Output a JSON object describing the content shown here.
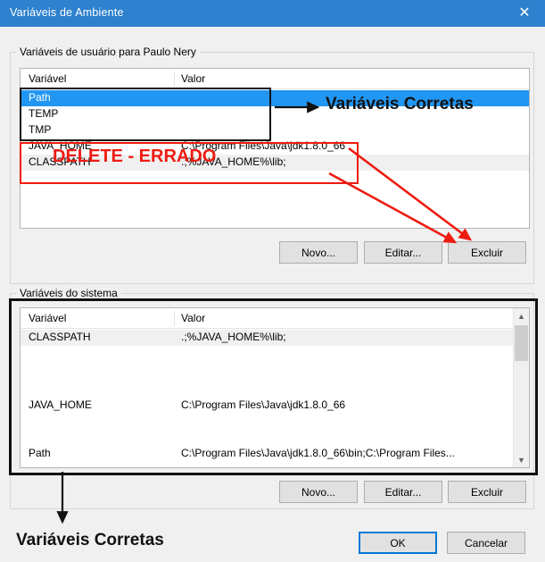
{
  "window": {
    "title": "Variáveis de Ambiente",
    "close_icon": "close-icon",
    "titlebar_color": "#2e81ce"
  },
  "user_section": {
    "legend": "Variáveis de usuário para Paulo Nery",
    "columns": {
      "name": "Variável",
      "value": "Valor"
    },
    "rows": [
      {
        "name": "Path",
        "value": "",
        "selected": true
      },
      {
        "name": "TEMP",
        "value": "",
        "selected": false
      },
      {
        "name": "TMP",
        "value": "",
        "selected": false
      },
      {
        "name": "JAVA_HOME",
        "value": "C:\\Program Files\\Java\\jdk1.8.0_66",
        "selected": false
      },
      {
        "name": "CLASSPATH",
        "value": ".;%JAVA_HOME%\\lib;",
        "selected": false
      }
    ],
    "buttons": {
      "new": "Novo...",
      "edit": "Editar...",
      "delete": "Excluir"
    }
  },
  "system_section": {
    "legend": "Variáveis do sistema",
    "columns": {
      "name": "Variável",
      "value": "Valor"
    },
    "rows": [
      {
        "name": "CLASSPATH",
        "value": ".;%JAVA_HOME%\\lib;"
      },
      {
        "name": "JAVA_HOME",
        "value": "C:\\Program Files\\Java\\jdk1.8.0_66"
      },
      {
        "name": "Path",
        "value": "C:\\Program Files\\Java\\jdk1.8.0_66\\bin;C:\\Program Files..."
      }
    ],
    "buttons": {
      "new": "Novo...",
      "edit": "Editar...",
      "delete": "Excluir"
    },
    "scrollbar": {
      "up_icon": "chevron-up-icon",
      "down_icon": "chevron-down-icon"
    }
  },
  "dialog_buttons": {
    "ok": "OK",
    "cancel": "Cancelar"
  },
  "annotations": {
    "correct_top": "Variáveis Corretas",
    "correct_bottom": "Variáveis Corretas",
    "delete_wrong": "DELETE - ERRADO",
    "colors": {
      "red": "#ee1b11",
      "black": "#111111",
      "accent": "#0078d7",
      "selection": "#2196f3"
    }
  }
}
